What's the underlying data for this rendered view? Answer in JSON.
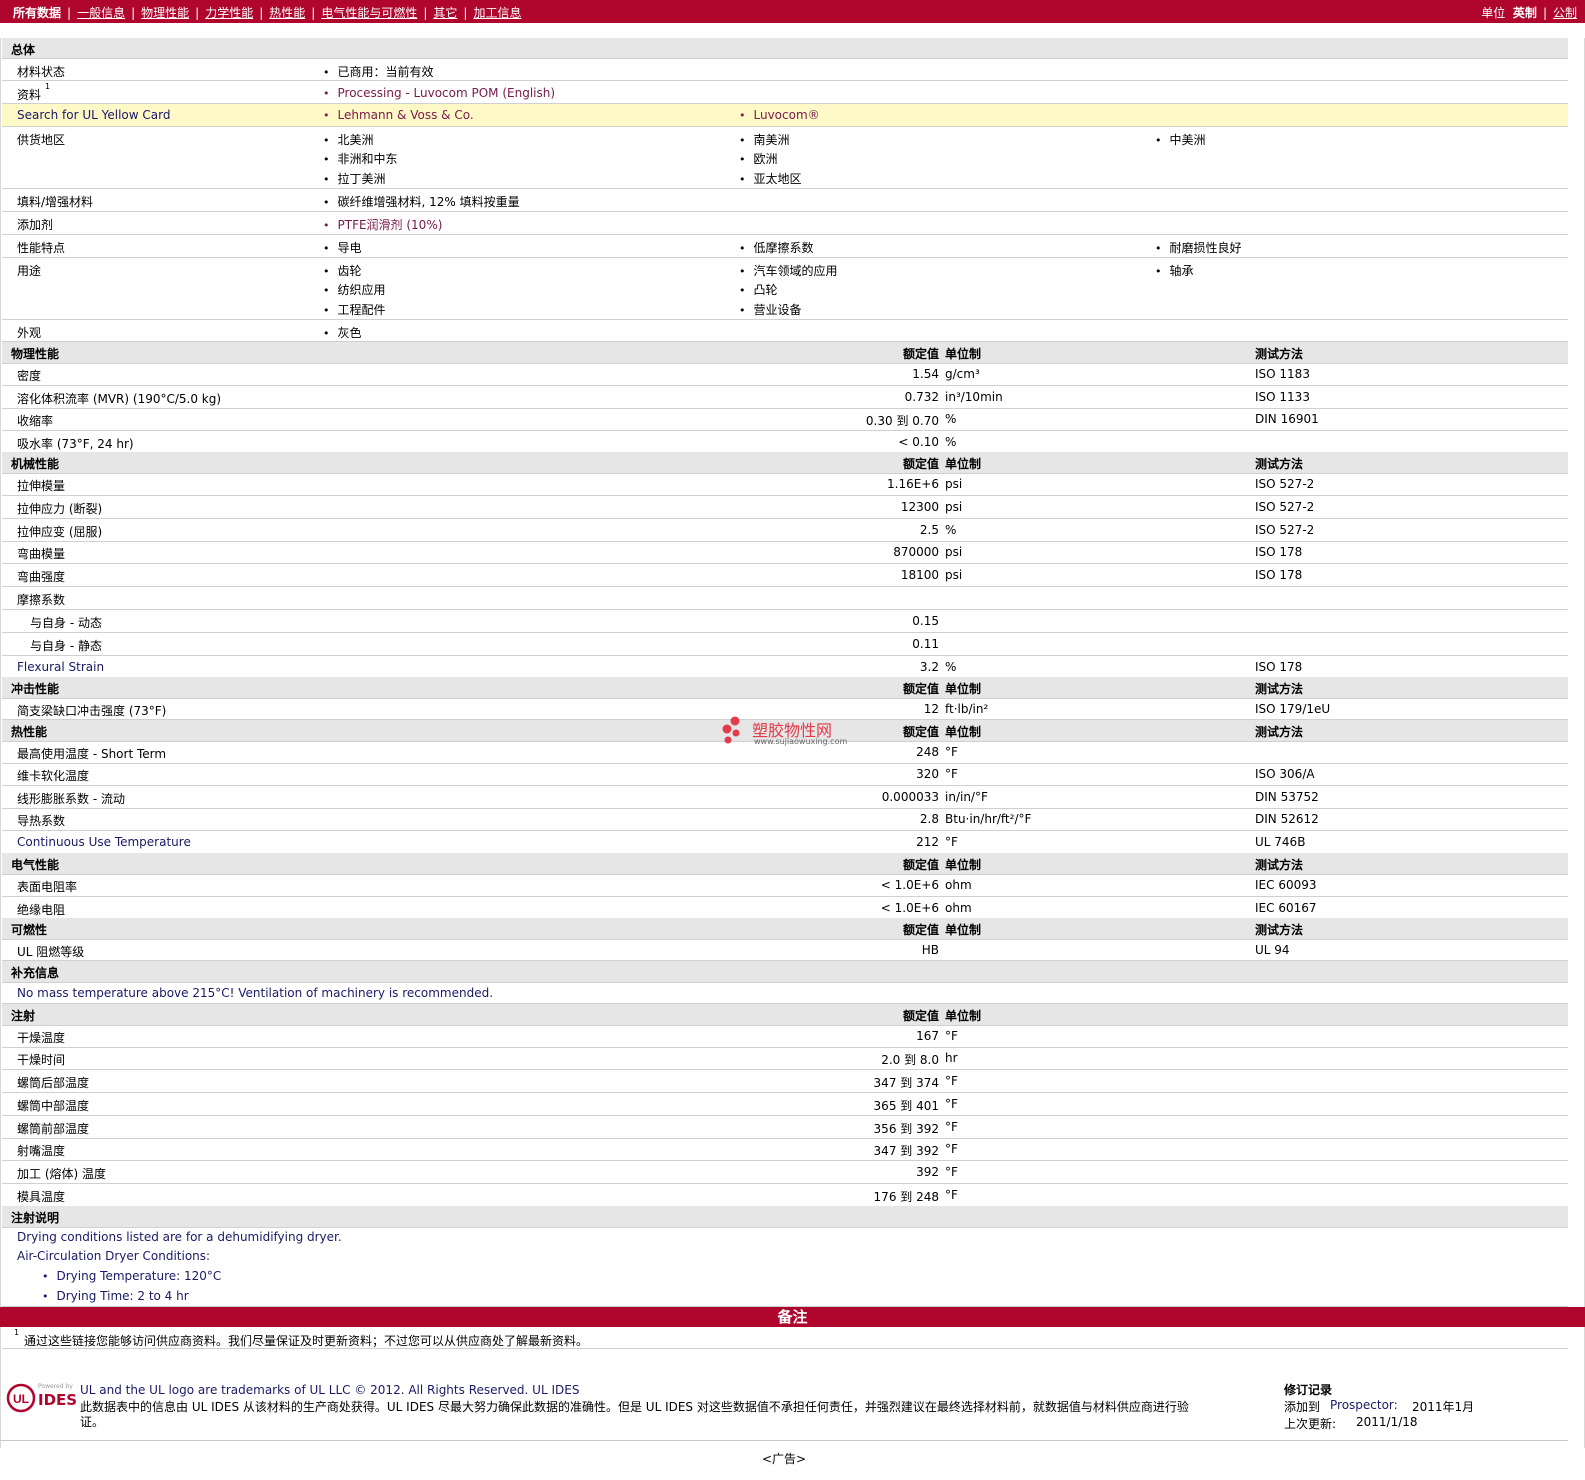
{
  "nav": {
    "active": "所有数据",
    "links": [
      "一般信息",
      "物理性能",
      "力学性能",
      "热性能",
      "电气性能与可燃性",
      "其它",
      "加工信息"
    ],
    "unit_label": "单位",
    "unit_active": "英制",
    "unit_other": "公制"
  },
  "general": {
    "title": "总体",
    "status_label": "材料状态",
    "status_value": "已商用：当前有效",
    "docs_label": "资料",
    "docs_sup": "1",
    "docs_value": "Processing - Luvocom POM (English)",
    "ul_label": "Search for UL Yellow Card",
    "ul_val1": "Lehmann & Voss & Co.",
    "ul_val2": "Luvocom®",
    "region_label": "供货地区",
    "regions": [
      "北美洲",
      "南美洲",
      "中美洲",
      "非洲和中东",
      "欧洲",
      "拉丁美洲",
      "亚太地区"
    ],
    "filler_label": "填料/增强材料",
    "filler_value": "碳纤维增强材料, 12% 填料按重量",
    "additive_label": "添加剂",
    "additive_value": "PTFE润滑剂 (10%)",
    "features_label": "性能特点",
    "features": [
      "导电",
      "低摩擦系数",
      "耐磨损性良好"
    ],
    "uses_label": "用途",
    "uses": [
      "齿轮",
      "汽车领域的应用",
      "轴承",
      "纺织应用",
      "凸轮",
      "工程配件",
      "营业设备"
    ],
    "appearance_label": "外观",
    "appearance_value": "灰色"
  },
  "headers": {
    "nominal": "额定值",
    "unit": "单位制",
    "method": "测试方法"
  },
  "physical": {
    "title": "物理性能",
    "rows": [
      {
        "name": "密度",
        "value": "1.54",
        "unit": "g/cm³",
        "method": "ISO 1183"
      },
      {
        "name": "溶化体积流率 (MVR)  (190°C/5.0 kg)",
        "value": "0.732",
        "unit": "in³/10min",
        "method": "ISO 1133"
      },
      {
        "name": "收缩率",
        "value": "0.30 到  0.70",
        "unit": "%",
        "method": "DIN 16901"
      },
      {
        "name": "吸水率 (73°F, 24 hr)",
        "value": "< 0.10",
        "unit": "%",
        "method": ""
      }
    ]
  },
  "mechanical": {
    "title": "机械性能",
    "rows": [
      {
        "name": "拉伸模量",
        "value": "1.16E+6",
        "unit": "psi",
        "method": "ISO 527-2"
      },
      {
        "name": "拉伸应力 (断裂)",
        "value": "12300",
        "unit": "psi",
        "method": "ISO 527-2"
      },
      {
        "name": "拉伸应变 (屈服)",
        "value": "2.5",
        "unit": "%",
        "method": "ISO 527-2"
      },
      {
        "name": "弯曲模量",
        "value": "870000",
        "unit": "psi",
        "method": "ISO 178"
      },
      {
        "name": "弯曲强度",
        "value": "18100",
        "unit": "psi",
        "method": "ISO 178"
      },
      {
        "name": "摩擦系数",
        "value": "",
        "unit": "",
        "method": ""
      },
      {
        "name": "与自身  - 动态",
        "value": "0.15",
        "unit": "",
        "method": ""
      },
      {
        "name": "与自身  - 静态",
        "value": "0.11",
        "unit": "",
        "method": ""
      },
      {
        "name": "Flexural Strain",
        "value": "3.2",
        "unit": "%",
        "method": "ISO 178"
      }
    ]
  },
  "impact": {
    "title": "冲击性能",
    "rows": [
      {
        "name": "简支梁缺口冲击强度 (73°F)",
        "value": "12",
        "unit": "ft·lb/in²",
        "method": "ISO 179/1eU"
      }
    ]
  },
  "thermal": {
    "title": "热性能",
    "rows": [
      {
        "name": "最高使用温度  - Short Term",
        "value": "248",
        "unit": "°F",
        "method": ""
      },
      {
        "name": "维卡软化温度",
        "value": "320",
        "unit": "°F",
        "method": "ISO 306/A"
      },
      {
        "name": "线形膨胀系数  - 流动",
        "value": "0.000033",
        "unit": "in/in/°F",
        "method": "DIN 53752"
      },
      {
        "name": "导热系数",
        "value": "2.8",
        "unit": "Btu·in/hr/ft²/°F",
        "method": "DIN 52612"
      },
      {
        "name": "Continuous Use Temperature",
        "value": "212",
        "unit": "°F",
        "method": "UL 746B"
      }
    ]
  },
  "electrical": {
    "title": "电气性能",
    "rows": [
      {
        "name": "表面电阻率",
        "value": "< 1.0E+6",
        "unit": "ohm",
        "method": "IEC 60093"
      },
      {
        "name": "绝缘电阻",
        "value": "< 1.0E+6",
        "unit": "ohm",
        "method": "IEC 60167"
      }
    ]
  },
  "flammability": {
    "title": "可燃性",
    "rows": [
      {
        "name": "UL 阻燃等级",
        "value": "HB",
        "unit": "",
        "method": "UL 94"
      }
    ]
  },
  "supplement": {
    "title": "补充信息",
    "text": "No mass temperature above 215°C! Ventilation of machinery is recommended."
  },
  "injection": {
    "title": "注射",
    "rows": [
      {
        "name": "干燥温度",
        "value": "167",
        "unit": "°F"
      },
      {
        "name": "干燥时间",
        "value": "2.0 到  8.0",
        "unit": "hr"
      },
      {
        "name": "螺筒后部温度",
        "value": "347 到  374",
        "unit": "°F"
      },
      {
        "name": "螺筒中部温度",
        "value": "365 到  401",
        "unit": "°F"
      },
      {
        "name": "螺筒前部温度",
        "value": "356 到  392",
        "unit": "°F"
      },
      {
        "name": "射嘴温度",
        "value": "347 到  392",
        "unit": "°F"
      },
      {
        "name": "加工 (熔体) 温度",
        "value": "392",
        "unit": "°F"
      },
      {
        "name": "模具温度",
        "value": "176 到  248",
        "unit": "°F"
      }
    ]
  },
  "injection_notes": {
    "title": "注射说明",
    "line1": "Drying conditions listed are for a dehumidifying dryer.",
    "line2": "Air-Circulation Dryer Conditions:",
    "bullets": [
      "Drying Temperature: 120°C",
      "Drying Time: 2 to 4 hr"
    ]
  },
  "notes": {
    "title": "备注",
    "sup": "1",
    "text": "通过这些链接您能够访问供应商资料。我们尽量保证及时更新资料；不过您可以从供应商处了解最新资料。"
  },
  "watermark": {
    "name": "塑胶物性网",
    "url": "www.sujiaowuxing.com"
  },
  "footer": {
    "logo_small": "Powered by",
    "logo_ul": "UL",
    "logo_ides": "IDES",
    "line1": "UL and the UL logo are trademarks of UL LLC © 2012. All Rights Reserved. UL IDES",
    "line2": "此数据表中的信息由  UL IDES 从该材料的生产商处获得。UL IDES 尽最大努力确保此数据的准确性。但是  UL IDES 对这些数据值不承担任何责任，并强烈建议在最终选择材料前，就数据值与材料供应商进行验",
    "line3": "证。",
    "rev_title": "修订记录",
    "rev_added_label": "添加到",
    "rev_added_link": "Prospector:",
    "rev_added_value": "2011年1月",
    "rev_updated_label": "上次更新:",
    "rev_updated_value": "2011/1/18",
    "ad": "<广告>"
  }
}
